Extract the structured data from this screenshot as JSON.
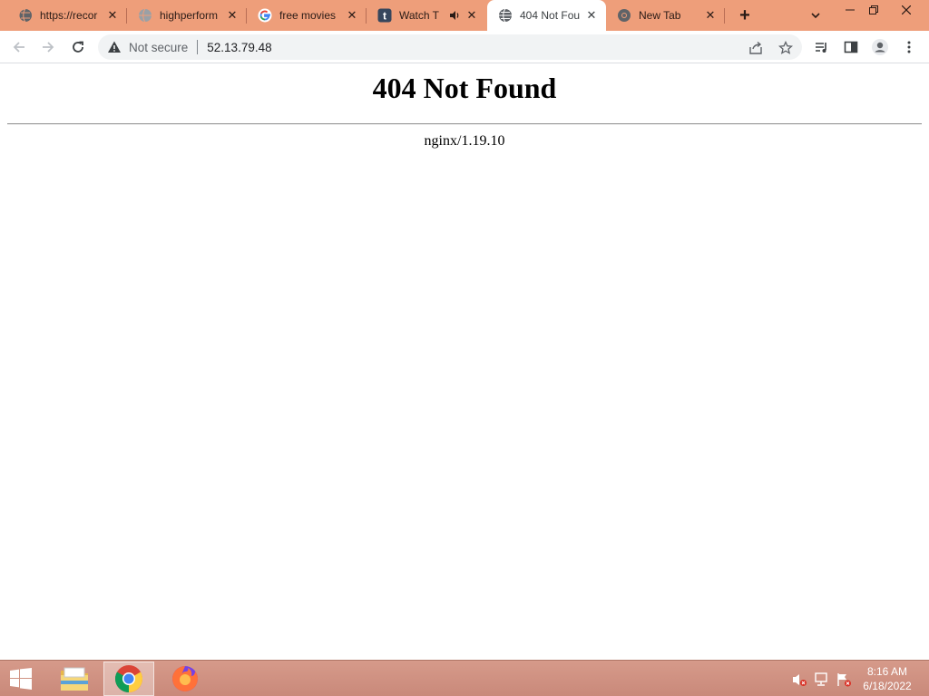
{
  "browser": {
    "tabs": [
      {
        "title": "https://recor",
        "icon": "globe-icon"
      },
      {
        "title": "highperform",
        "icon": "globe-gray-icon"
      },
      {
        "title": "free movies",
        "icon": "google-icon"
      },
      {
        "title": "Watch T",
        "icon": "tumblr-icon",
        "audio": "speaker-icon"
      },
      {
        "title": "404 Not Fou",
        "icon": "globe-icon",
        "active": true
      },
      {
        "title": "New Tab",
        "icon": "chrome-icon"
      }
    ],
    "new_tab_label": "+",
    "security_label": "Not secure",
    "url": "52.13.79.48"
  },
  "page": {
    "heading": "404 Not Found",
    "server_signature": "nginx/1.19.10"
  },
  "taskbar": {
    "apps": [
      "file-explorer-icon",
      "chrome-icon",
      "firefox-icon"
    ],
    "clock": {
      "time": "8:16 AM",
      "date": "6/18/2022"
    }
  },
  "colors": {
    "tabstrip": "#ee9e7a",
    "taskbar": "#d69a8a",
    "accent_chrome_red": "#db4437"
  }
}
